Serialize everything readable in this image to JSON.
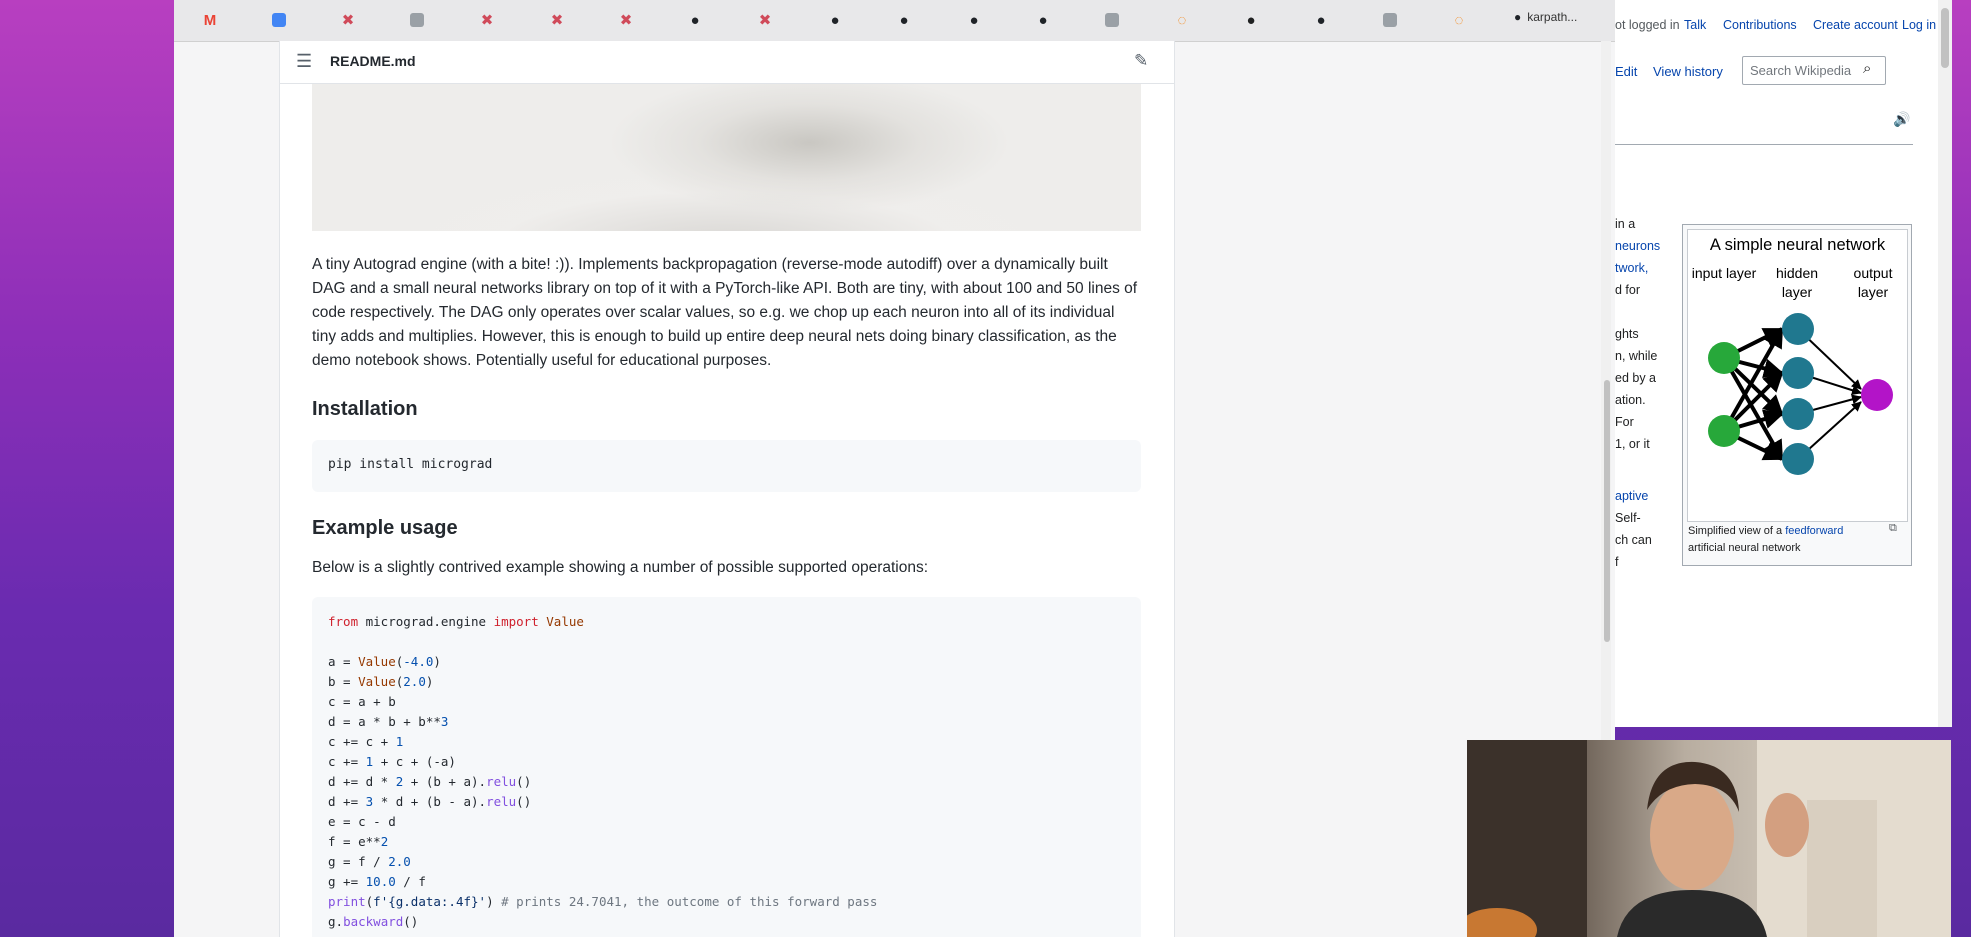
{
  "browser_tabs": {
    "last_tab_label": "karpath..."
  },
  "readme": {
    "file_name": "README.md",
    "intro": "A tiny Autograd engine (with a bite! :)). Implements backpropagation (reverse-mode autodiff) over a dynamically built DAG and a small neural networks library on top of it with a PyTorch-like API. Both are tiny, with about 100 and 50 lines of code respectively. The DAG only operates over scalar values, so e.g. we chop up each neuron into all of its individual tiny adds and multiplies. However, this is enough to build up entire deep neural nets doing binary classification, as the demo notebook shows. Potentially useful for educational purposes.",
    "install_heading": "Installation",
    "install_cmd": "pip install micrograd",
    "usage_heading": "Example usage",
    "usage_desc": "Below is a slightly contrived example showing a number of possible supported operations:"
  },
  "wiki": {
    "not_logged_in": "ot logged in",
    "talk": "Talk",
    "contributions": "Contributions",
    "create_account": "Create account",
    "log_in": "Log in",
    "edit": "Edit",
    "view_history": "View history",
    "search_placeholder": "Search Wikipedia",
    "body_fragments": [
      "in a",
      "neurons",
      "twork,",
      "d for",
      "ghts",
      "n, while",
      "ed by a",
      "ation.",
      " For",
      "1, or it",
      "aptive",
      "Self-",
      "ch can",
      "f"
    ],
    "infobox": {
      "title": "A simple neural network",
      "layer_input": "input layer",
      "layer_hidden": "hidden layer",
      "layer_output": "output layer",
      "caption_prefix": "Simplified view of a ",
      "caption_link": "feedforward",
      "caption_suffix": "artificial neural network"
    }
  },
  "colors": {
    "input_node": "#27a83a",
    "hidden_node": "#20788f",
    "output_node": "#b314c8",
    "link": "#0645ad"
  }
}
